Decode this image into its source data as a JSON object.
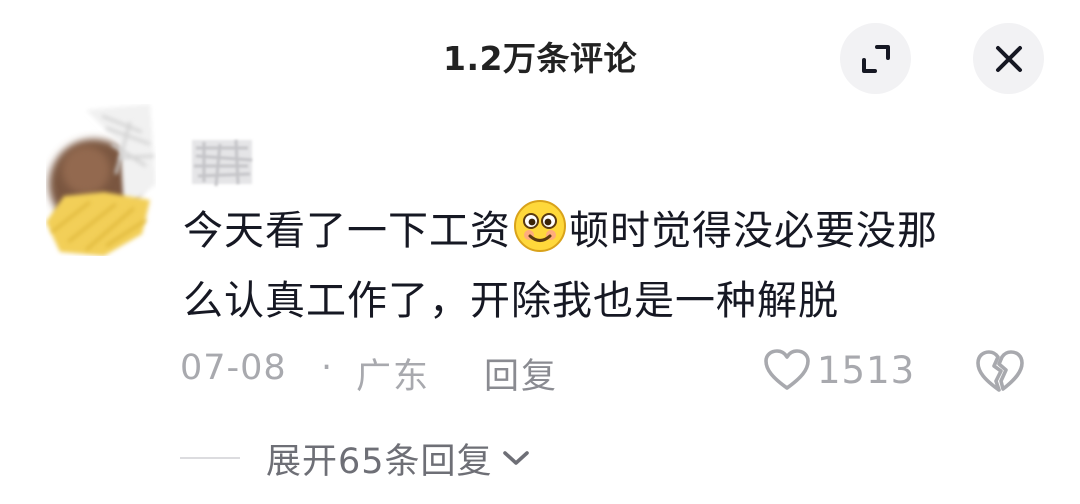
{
  "header": {
    "title": "1.2万条评论",
    "expand_icon": "expand-icon",
    "close_icon": "close-icon"
  },
  "comment": {
    "avatar_icon": "blurred-avatar",
    "text_line1_a": "今天看了一下工资",
    "emoji": "smile-emoji",
    "text_line1_b": "顿时觉得没必要没那",
    "text_line2": "么认真工作了，开除我也是一种解脱",
    "date": "07-08",
    "separator": "·",
    "location": "广东",
    "reply_label": "回复",
    "like_count": "1513",
    "like_icon": "heart-outline-icon",
    "dislike_icon": "broken-heart-icon"
  },
  "replies": {
    "expand_label": "展开65条回复",
    "chevron_icon": "chevron-down-icon"
  },
  "colors": {
    "text_primary": "#161823",
    "text_secondary": "#a8a9ae",
    "button_bg": "#f2f2f4",
    "emoji_face": "#ffd83b"
  }
}
